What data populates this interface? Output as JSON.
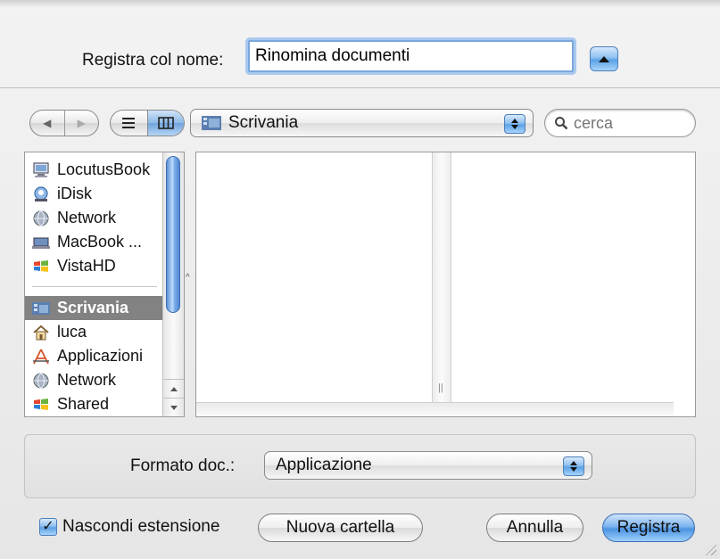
{
  "save_as": {
    "label": "Registra col nome:",
    "value": "Rinomina documenti"
  },
  "location": {
    "selected": "Scrivania"
  },
  "search": {
    "placeholder": "cerca"
  },
  "sidebar": {
    "devices": [
      {
        "label": "LocutusBook",
        "icon": "computer-icon"
      },
      {
        "label": "iDisk",
        "icon": "idisk-icon"
      },
      {
        "label": "Network",
        "icon": "network-globe-icon"
      },
      {
        "label": "MacBook ...",
        "icon": "laptop-drive-icon"
      },
      {
        "label": "VistaHD",
        "icon": "windows-drive-icon"
      }
    ],
    "places": [
      {
        "label": "Scrivania",
        "icon": "desktop-folder-icon",
        "selected": true
      },
      {
        "label": "luca",
        "icon": "home-icon"
      },
      {
        "label": "Applicazioni",
        "icon": "applications-icon"
      },
      {
        "label": "Network",
        "icon": "network-globe-icon"
      },
      {
        "label": "Shared",
        "icon": "shared-drive-icon"
      }
    ]
  },
  "format": {
    "label": "Formato doc.:",
    "selected": "Applicazione"
  },
  "hide_extension": {
    "label": "Nascondi estensione",
    "checked": true
  },
  "buttons": {
    "new_folder": "Nuova cartella",
    "cancel": "Annulla",
    "save": "Registra"
  },
  "colors": {
    "accent": "#5aa1e6",
    "selection": "#828282",
    "panel": "#e6e6e6"
  }
}
